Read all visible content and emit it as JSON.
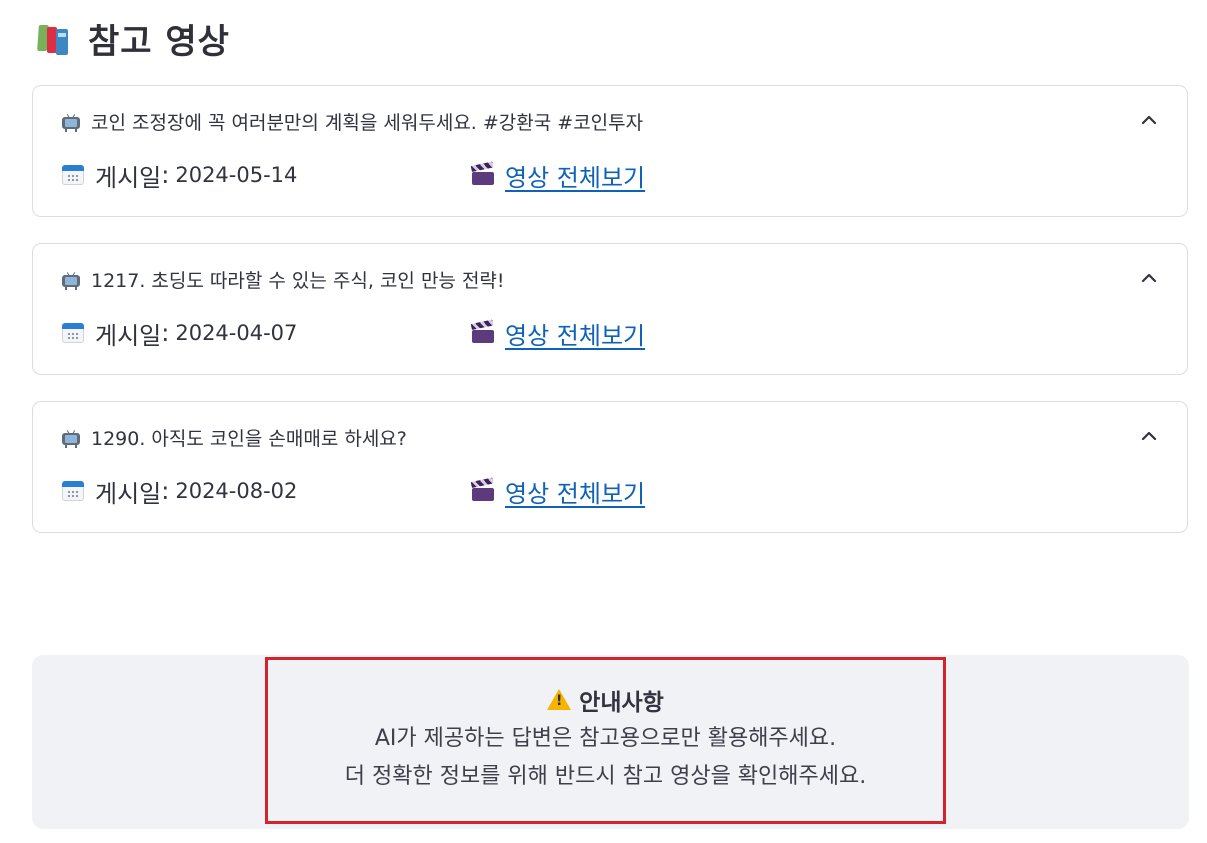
{
  "page": {
    "title": "참고 영상",
    "title_icon": "books-icon"
  },
  "videos": [
    {
      "title": "코인 조정장에 꼭 여러분만의 계획을 세워두세요. #강환국 #코인투자",
      "posted_label": "게시일",
      "posted_date": "2024-05-14",
      "link_label": "영상 전체보기"
    },
    {
      "title": "1217. 초딩도 따라할 수 있는 주식, 코인 만능 전략!",
      "posted_label": "게시일",
      "posted_date": "2024-04-07",
      "link_label": "영상 전체보기"
    },
    {
      "title": "1290. 아직도 코인을 손매매로 하세요?",
      "posted_label": "게시일",
      "posted_date": "2024-08-02",
      "link_label": "영상 전체보기"
    }
  ],
  "notice": {
    "title": "안내사항",
    "line1": "AI가 제공하는 답변은 참고용으로만 활용해주세요.",
    "line2": "더 정확한 정보를 위해 반드시 참고 영상을 확인해주세요."
  },
  "colors": {
    "link": "#0f62b8",
    "highlight_border": "#d4232f",
    "notice_bg": "#f1f2f6"
  }
}
